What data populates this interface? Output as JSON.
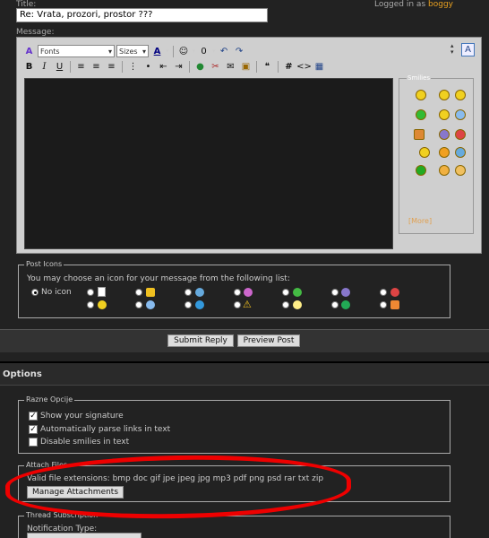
{
  "header": {
    "title_label": "Title:",
    "title_value": "Re: Vrata, prozori, prostor ???",
    "logged_in_prefix": "Logged in as",
    "username": "boggy",
    "message_label": "Message:"
  },
  "editor": {
    "font_select": "Fonts",
    "size_select": "Sizes",
    "smilies_legend": "Smilies",
    "more_link": "[More]"
  },
  "post_icons": {
    "legend": "Post Icons",
    "prompt": "You may choose an icon for your message from the following list:",
    "no_icon": "No icon"
  },
  "actions": {
    "submit": "Submit Reply",
    "preview": "Preview Post"
  },
  "options": {
    "heading": "Options",
    "misc_legend": "Razne Opcije",
    "show_signature": "Show your signature",
    "parse_links": "Automatically parse links in text",
    "disable_smilies": "Disable smilies in text"
  },
  "attach": {
    "legend": "Attach Files",
    "extensions": "Valid file extensions: bmp doc gif jpe jpeg jpg mp3 pdf png psd rar txt zip",
    "manage_button": "Manage Attachments"
  },
  "subscription": {
    "legend": "Thread Subscription",
    "notification_label": "Notification Type:"
  },
  "colors": {
    "background": "#222222",
    "accent_username": "#e8a020",
    "annotation_red": "#ee0000"
  }
}
